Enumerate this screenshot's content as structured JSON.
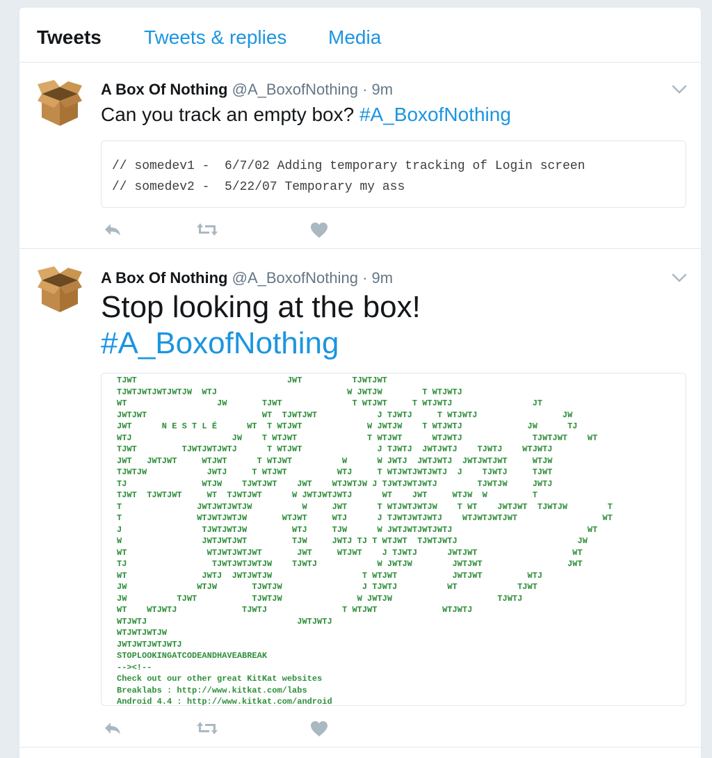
{
  "tabs": [
    "Tweets",
    "Tweets & replies",
    "Media"
  ],
  "colors": {
    "accent": "#1b95e0",
    "ascii": "#2f8f3b",
    "icon": "#aab8c2"
  },
  "tweets": [
    {
      "name": "A Box Of Nothing",
      "handle": "@A_BoxofNothing",
      "separator": "·",
      "time": "9m",
      "text": "Can you track an empty box?",
      "hashtag": "#A_BoxofNothing",
      "code_lines": [
        "// somedev1 -  6/7/02 Adding temporary tracking of Login screen",
        "// somedev2 -  5/22/07 Temporary my ass"
      ]
    },
    {
      "name": "A Box Of Nothing",
      "handle": "@A_BoxofNothing",
      "separator": "·",
      "time": "9m",
      "text": "Stop looking at the box!",
      "hashtag": "#A_BoxofNothing",
      "ascii_lines": [
        "TJWT                              JWT          TJWTJWT",
        "TJWTJWTJWTJWTJW  WTJ                          W JWTJW        T WTJWTJ",
        "WT                  JW       TJWT              T WTJWT     T WTJWTJ                JT",
        "JWTJWT                       WT  TJWTJWT            J TJWTJ     T WTJWTJ                 JW",
        "JWT      N E S T L É      WT  T WTJWT             W JWTJW    T WTJWTJ             JW      TJ",
        "WTJ                    JW    T WTJWT              T WTJWT      WTJWTJ              TJWTJWT    WT",
        "TJWT         TJWTJWTJWTJ      T WTJWT               J TJWTJ  JWTJWTJ    TJWTJ    WTJWTJ",
        "JWT   JWTJWT     WTJWT      T WTJWT          W      W JWTJ  JWTJWTJ  JWTJWTJWT     WTJW",
        "TJWTJW            JWTJ     T WTJWT          WTJ     T WTJWTJWTJWTJ  J    TJWTJ     TJWT",
        "TJ               WTJW    TJWTJWT    JWT    WTJWTJW J TJWTJWTJWTJ        TJWTJW     JWTJ",
        "TJWT  TJWTJWT     WT  TJWTJWT      W JWTJWTJWTJ      WT    JWT     WTJW  W         T",
        "T               JWTJWTJWTJW          W     JWT      T WTJWTJWTJW    T WT    JWTJWT  TJWTJW        T",
        "T               WTJWTJWTJW       WTJWT     WTJ      J TJWTJWTJWTJ    WTJWTJWTJWT                 WT",
        "J                TJWTJWTJW         WTJ     TJW      W JWTJWTJWTJWTJ                           WT",
        "W                JWTJWTJWT         TJW     JWTJ TJ T WTJWT  TJWTJWTJ                        JW",
        "WT                WTJWTJWTJWT       JWT     WTJWT    J TJWTJ      JWTJWT                   WT",
        "TJ                 TJWTJWTJWTJW    TJWTJ            W JWTJW        JWTJWT                 JWT",
        "WT               JWTJ  JWTJWTJW                  T WTJWT           JWTJWT         WTJ",
        "JW              WTJW       TJWTJW                J TJWTJ          WT            TJWT",
        "JW          TJWT           TJWTJW               W JWTJW                     TJWTJ",
        "WT    WTJWTJ             TJWTJ               T WTJWT             WTJWTJ",
        "WTJWTJ                              JWTJWTJ",
        "WTJWTJWTJW",
        "JWTJWTJWTJWTJ",
        "STOPLOOKINGATCODEANDHAVEABREAK",
        "--><!--",
        "Check out our other great KitKat websites",
        "Breaklabs : http://www.kitkat.com/labs",
        "Android 4.4 : http://www.kitkat.com/android"
      ]
    }
  ]
}
